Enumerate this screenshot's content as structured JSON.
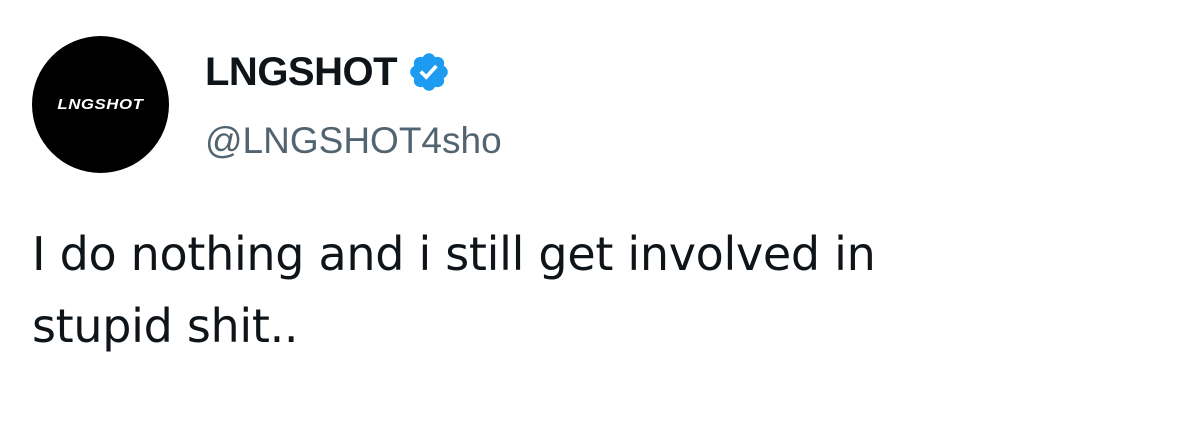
{
  "author": {
    "avatar_logo_text": "LNGSHOT",
    "display_name": "LNGSHOT",
    "handle": "@LNGSHOT4sho",
    "verified": true
  },
  "tweet": {
    "text_line_1": "I do nothing and i still get involved in",
    "text_line_2": "stupid shit.."
  },
  "colors": {
    "text_primary": "#0f1419",
    "text_secondary": "#536471",
    "verified_blue": "#1d9bf0",
    "avatar_background": "#000000",
    "page_background": "#ffffff"
  },
  "icons": {
    "verified": "verified-badge-icon"
  }
}
